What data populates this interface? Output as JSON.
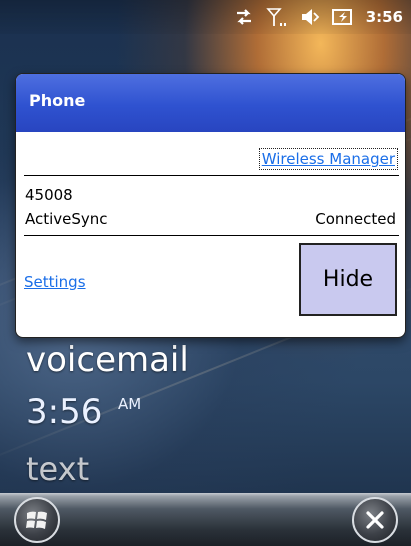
{
  "status_bar": {
    "icons": [
      "data-connection-icon",
      "signal-strength-icon",
      "volume-icon",
      "battery-charging-icon"
    ],
    "clock": "3:56"
  },
  "home": {
    "voicemail_label": "voicemail",
    "time": "3:56",
    "am_pm": "AM",
    "text_label": "text"
  },
  "popup": {
    "title": "Phone",
    "wireless_manager_link": "Wireless Manager",
    "carrier": "45008",
    "activesync_label": "ActiveSync",
    "activesync_status": "Connected",
    "settings_link": "Settings",
    "hide_button": "Hide"
  },
  "softkeys": {
    "left": "start-icon",
    "right": "close-icon"
  },
  "colors": {
    "popup_header": "#2f52d0",
    "link": "#1a6ee8",
    "hide_button_bg": "#c9c9ef"
  }
}
